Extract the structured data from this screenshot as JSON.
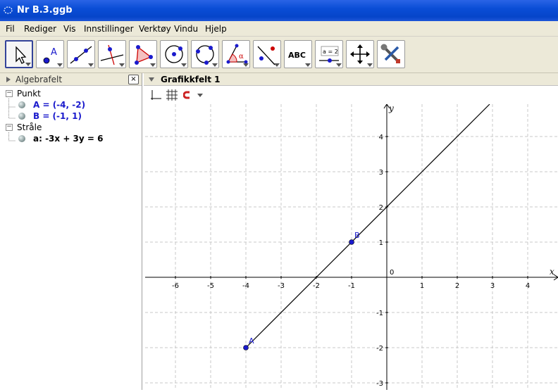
{
  "window": {
    "title": "Nr B.3.ggb"
  },
  "menu": [
    "Fil",
    "Rediger",
    "Vis",
    "Innstillinger",
    "Verktøy",
    "Vindu",
    "Hjelp"
  ],
  "toolbar": {
    "tools": [
      "move",
      "point",
      "line",
      "perpendicular",
      "polygon",
      "circle",
      "circle-through-points",
      "angle",
      "reflect",
      "text",
      "slider",
      "move-graphics",
      "tools"
    ],
    "text_tool_label": "ABC",
    "slider_tool_label": "a = 2"
  },
  "algebra": {
    "title": "Algebrafelt",
    "close": "×",
    "groups": [
      {
        "label": "Punkt",
        "items": [
          "A = (-4, -2)",
          "B = (-1, 1)"
        ]
      },
      {
        "label": "Stråle",
        "items": [
          "a: -3x + 3y = 6"
        ]
      }
    ]
  },
  "graphics": {
    "title": "Grafikkfelt 1",
    "x_axis_label": "x",
    "y_axis_label": "y",
    "x_ticks": [
      "-6",
      "-5",
      "-4",
      "-3",
      "-2",
      "-1",
      "0",
      "1",
      "2",
      "3",
      "4"
    ],
    "y_ticks": [
      "4",
      "3",
      "2",
      "1",
      "-1",
      "-2",
      "-3"
    ],
    "points": [
      {
        "name": "A",
        "x": -4,
        "y": -2
      },
      {
        "name": "B",
        "x": -1,
        "y": 1
      }
    ],
    "ray": {
      "from": "A",
      "through": "B"
    },
    "colors": {
      "point": "#1a1acc",
      "grid": "#c8c8c8",
      "axis": "#000000",
      "line": "#000000"
    }
  }
}
